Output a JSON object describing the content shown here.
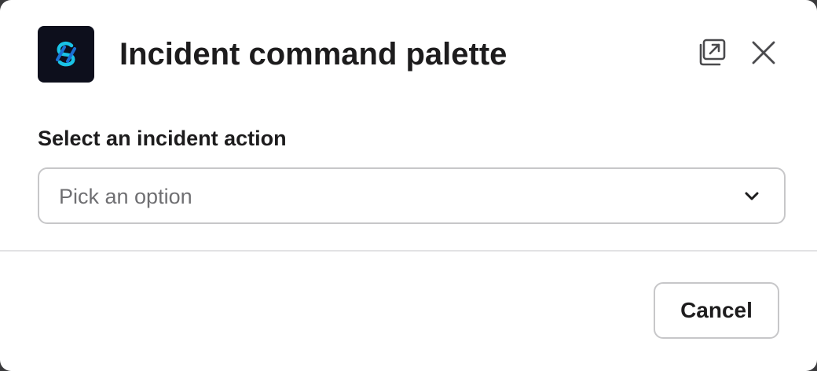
{
  "modal": {
    "title": "Incident command palette",
    "app_icon": "app-logo-icon",
    "popout_icon": "open-in-new-window-icon",
    "close_icon": "close-icon"
  },
  "form": {
    "action_label": "Select an incident action",
    "action_select": {
      "placeholder": "Pick an option",
      "icon": "chevron-down-icon"
    }
  },
  "footer": {
    "cancel_label": "Cancel"
  },
  "colors": {
    "app_icon_bg": "#0d0f1c",
    "app_icon_accent": "#19c3e6",
    "text": "#1d1c1d",
    "placeholder": "#6f6f72",
    "border": "#c7c7c9"
  }
}
